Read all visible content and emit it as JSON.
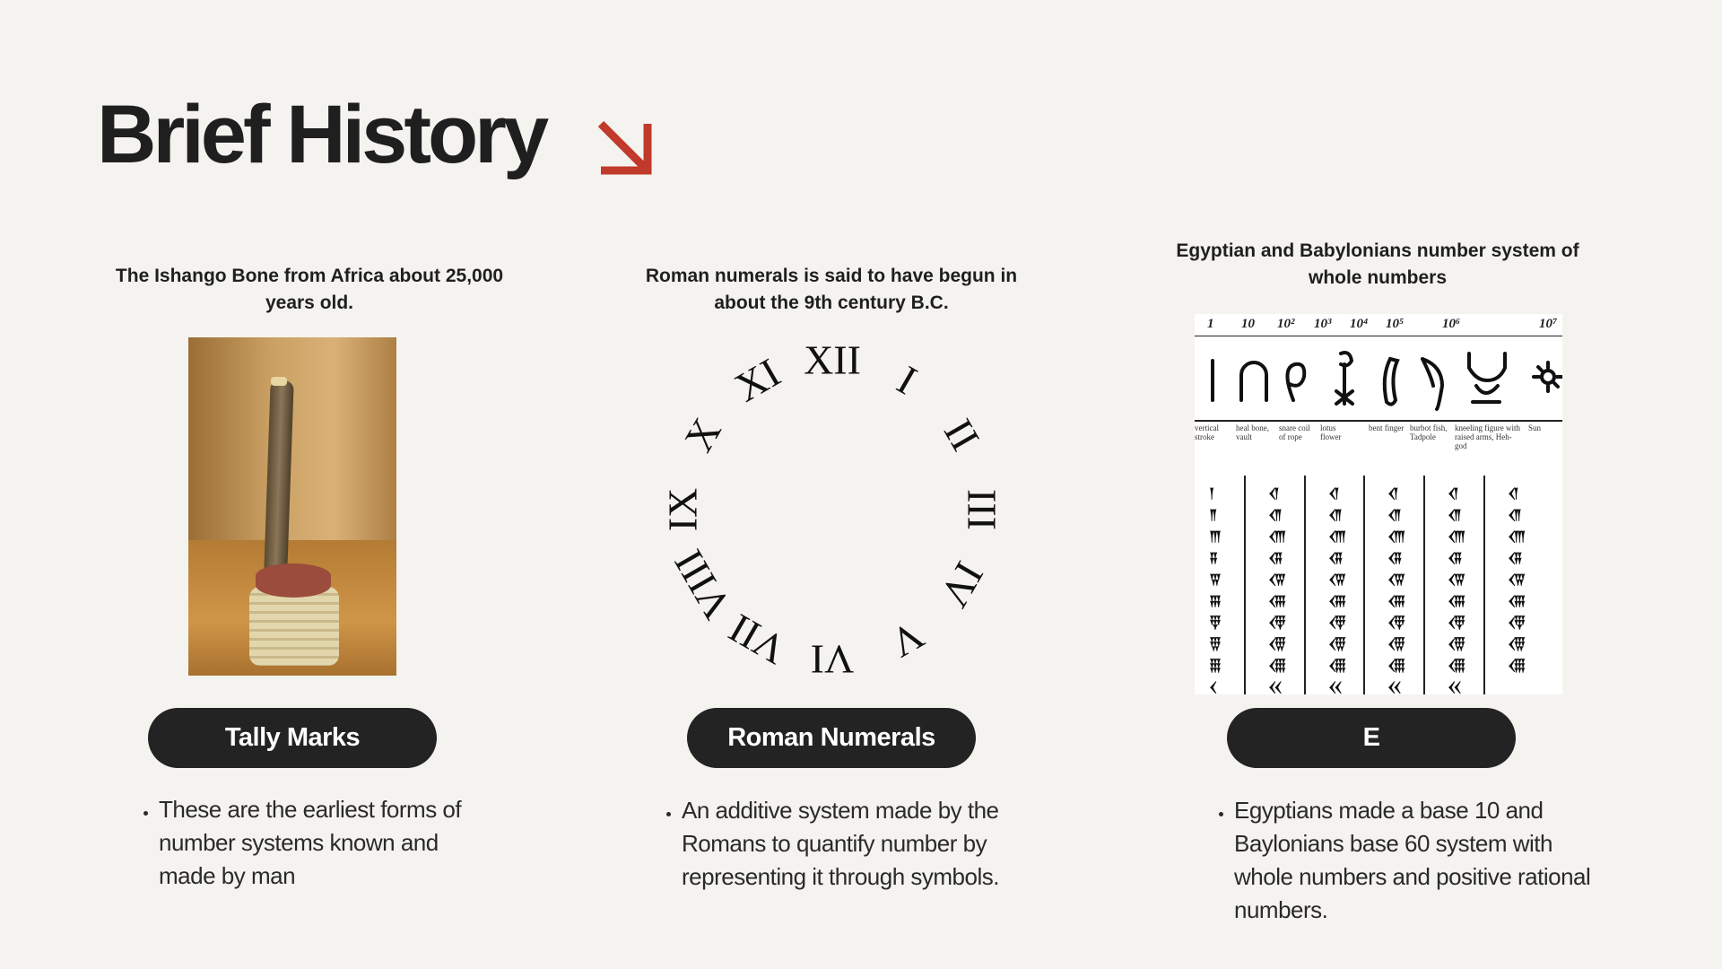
{
  "title": "Brief History",
  "accent_color": "#c0392b",
  "columns": [
    {
      "caption": "The Ishango Bone from Africa  about 25,000 years old.",
      "image": "ishango-bone-photo",
      "button_label": "Tally Marks",
      "bullet": "These are the earliest forms of number systems known and made by man"
    },
    {
      "caption": "Roman numerals is said to have begun in about the 9th century B.C.",
      "image": "roman-numeral-clock",
      "button_label": "Roman Numerals",
      "bullet": "An additive system made by the Romans to quantify number by representing it through symbols."
    },
    {
      "caption": "Egyptian and Babylonians number system of whole numbers",
      "image": "egyptian-babylonian-numerals-chart",
      "button_label": "E",
      "bullet": "Egyptians made a base 10 and Baylonians base 60 system with whole numbers and positive rational numbers."
    }
  ],
  "roman_numerals": [
    "XII",
    "I",
    "II",
    "III",
    "IV",
    "V",
    "VI",
    "VII",
    "VIII",
    "IX",
    "X",
    "XI"
  ],
  "egypt_chart": {
    "powers": [
      "1",
      "10",
      "10²",
      "10³",
      "10⁴",
      "10⁵",
      "10⁶",
      "10⁷"
    ],
    "names": [
      "vertical stroke",
      "heal bone, vault",
      "snare coil of rope",
      "lotus flower",
      "bent finger",
      "burbot fish, Tadpole",
      "kneeling figure with raised arms, Heh-god",
      "Sun"
    ]
  }
}
